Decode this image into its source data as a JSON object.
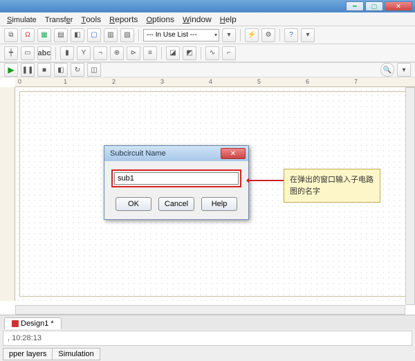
{
  "menu": {
    "simulate": "Simulate",
    "transfer": "Transfer",
    "tools": "Tools",
    "reports": "Reports",
    "options": "Options",
    "window": "Window",
    "help": "Help"
  },
  "toolbar": {
    "dropdown_label": "--- In Use List ---"
  },
  "ruler_marks": [
    "0",
    "1",
    "2",
    "3",
    "4",
    "5",
    "6",
    "7"
  ],
  "dialog": {
    "title": "Subcircuit Name",
    "input_value": "sub1",
    "ok": "OK",
    "cancel": "Cancel",
    "help": "Help"
  },
  "callout_text": "在弹出的窗口输入子电路图的名字",
  "doc_tab": "Design1 *",
  "status_time": ", 10:28:13",
  "mode_tabs": {
    "upper": "pper layers",
    "sim": "Simulation"
  }
}
